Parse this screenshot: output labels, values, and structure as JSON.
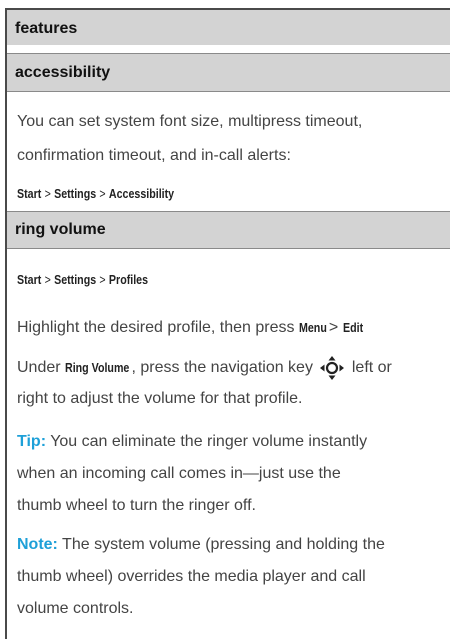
{
  "header": {
    "title": "features"
  },
  "accessibility": {
    "title": "accessibility",
    "line1": "You can set system font size, multipress timeout,",
    "line2": "confirmation timeout, and in-call alerts:",
    "path": [
      "Start",
      "Settings",
      "Accessibility"
    ]
  },
  "ring_volume": {
    "title": "ring volume",
    "path": [
      "Start",
      "Settings",
      "Profiles"
    ],
    "highlight_prefix": "Highlight the desired profile, then press",
    "menu_key": "Menu",
    "edit_key": "Edit",
    "under_prefix": "Under",
    "ring_volume_label": "Ring Volume",
    "under_text": ", press the navigation key",
    "under_text2": "left or",
    "under_line2": "right to adjust the volume for that profile.",
    "tip_label": "Tip:",
    "tip_line1": "You can eliminate the ringer volume instantly",
    "tip_line2": "when an incoming call comes in—just use the",
    "tip_line3": "thumb wheel to turn the ringer off.",
    "note_label": "Note:",
    "note_line1": "The system volume (pressing and holding the",
    "note_line2": "thumb wheel) overrides the media player and call",
    "note_line3": "volume controls."
  },
  "colors": {
    "accent": "#1ea0d8",
    "header_bg": "#d3d3d3"
  },
  "icons": {
    "nav_key": "navigation-key-icon"
  }
}
